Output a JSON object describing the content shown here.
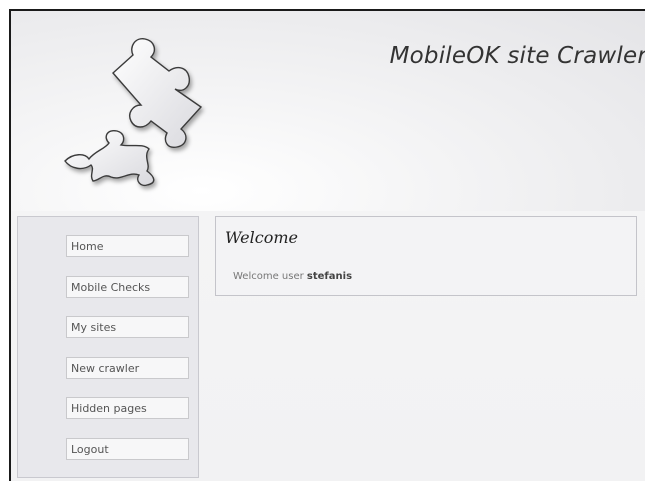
{
  "header": {
    "site_title": "MobileOK site Crawler",
    "logo_icon": "puzzle-pieces-icon"
  },
  "nav": {
    "items": [
      {
        "label": "Home"
      },
      {
        "label": "Mobile Checks"
      },
      {
        "label": "My sites"
      },
      {
        "label": "New crawler"
      },
      {
        "label": "Hidden pages"
      },
      {
        "label": "Logout"
      }
    ]
  },
  "main": {
    "title": "Welcome",
    "welcome_prefix": "Welcome user",
    "username": "stefanis"
  },
  "colors": {
    "panel_bg": "#e8e8ec",
    "border": "#c9c9cf",
    "text": "#555555"
  }
}
